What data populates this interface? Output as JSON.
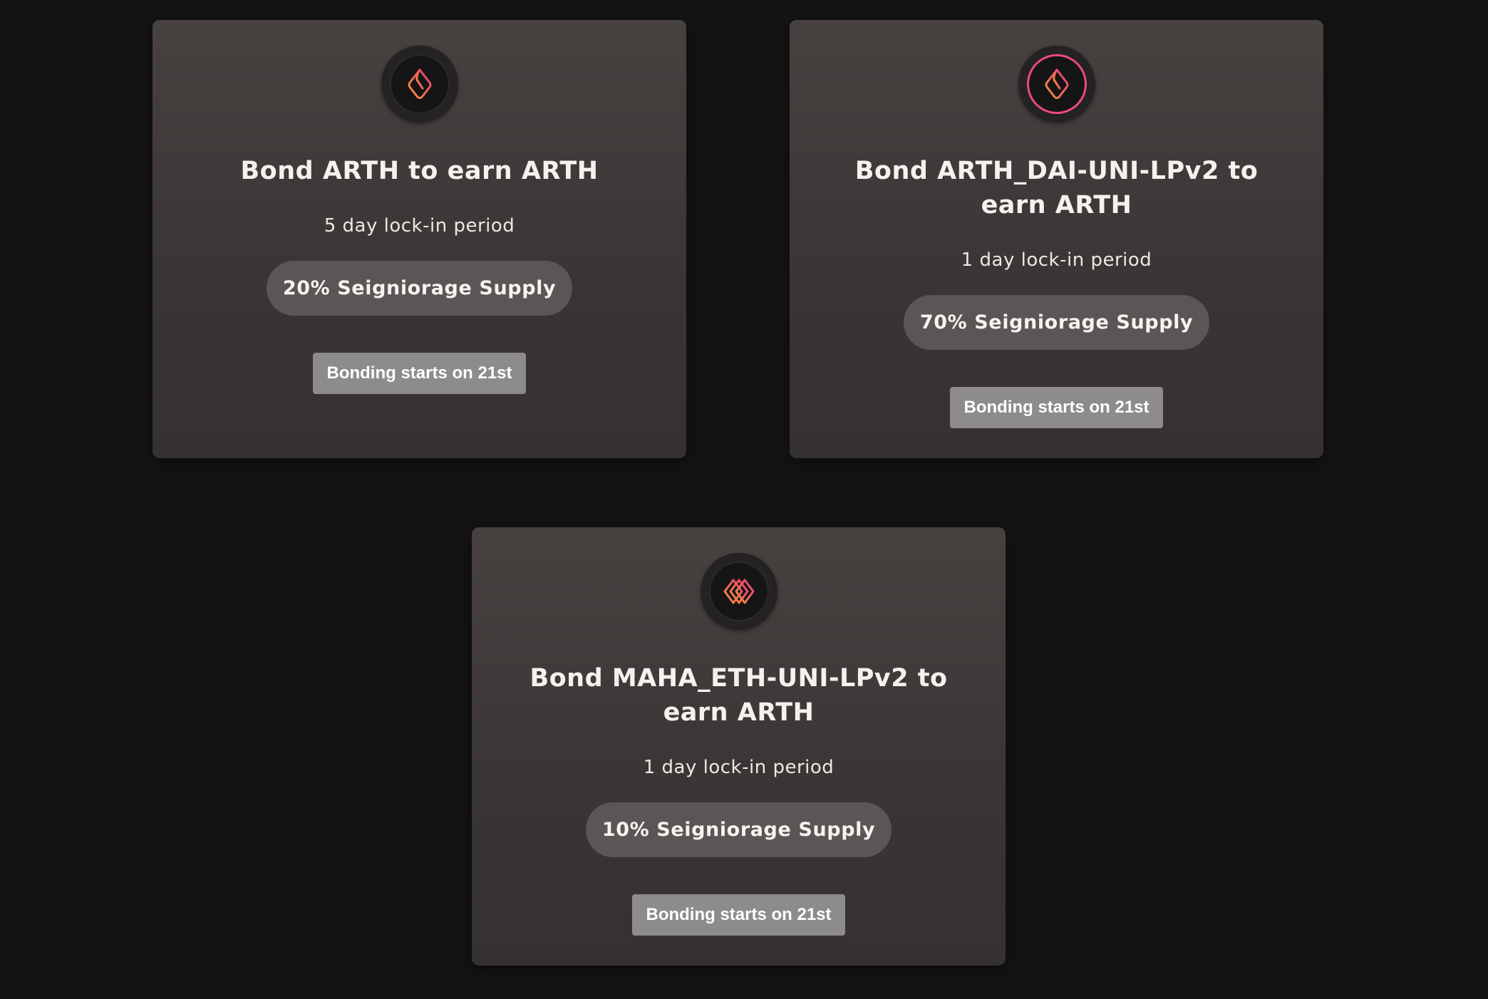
{
  "bonds": [
    {
      "title": "Bond ARTH to earn ARTH",
      "lock_period": "5 day lock-in period",
      "supply": "20% Seigniorage Supply",
      "button": "Bonding starts on 21st",
      "icon": "arth-token-icon"
    },
    {
      "title": "Bond ARTH_DAI-UNI-LPv2 to earn ARTH",
      "lock_period": "1 day lock-in period",
      "supply": "70% Seigniorage Supply",
      "button": "Bonding starts on 21st",
      "icon": "arth-dai-lp-token-icon"
    },
    {
      "title": "Bond MAHA_ETH-UNI-LPv2 to earn ARTH",
      "lock_period": "1 day lock-in period",
      "supply": "10% Seigniorage Supply",
      "button": "Bonding starts on 21st",
      "icon": "maha-eth-lp-token-icon"
    }
  ],
  "colors": {
    "background": "#141414",
    "card_top": "#474240",
    "card_bottom": "#363131",
    "pill": "#5a5656",
    "button": "#8e8b8b",
    "logo_gradient_start": "#f7943a",
    "logo_gradient_end": "#e8367c"
  }
}
